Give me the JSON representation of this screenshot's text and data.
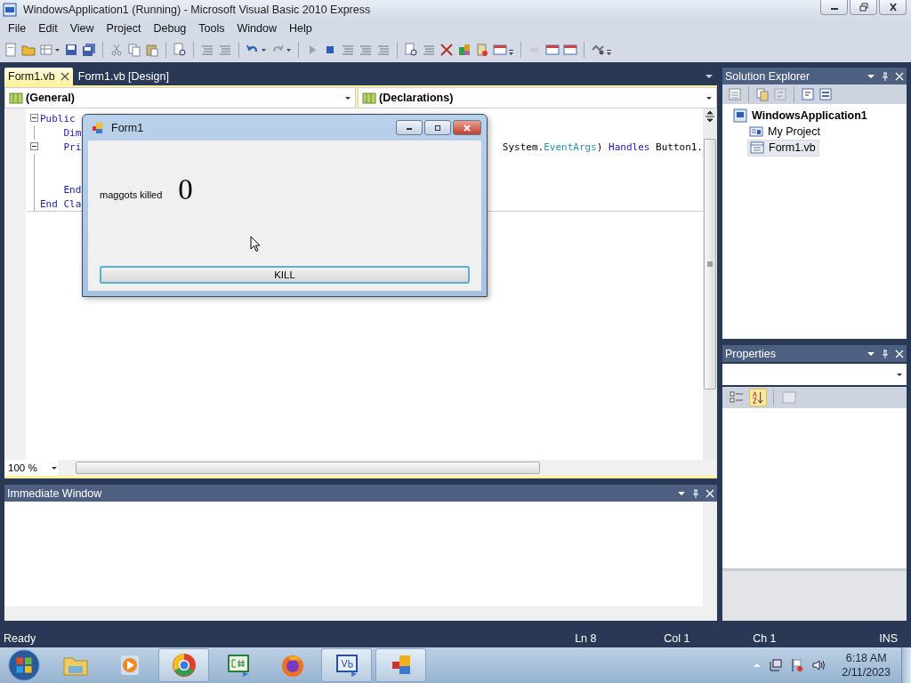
{
  "window": {
    "title": "WindowsApplication1 (Running) - Microsoft Visual Basic 2010 Express"
  },
  "menu": [
    "File",
    "Edit",
    "View",
    "Project",
    "Debug",
    "Tools",
    "Window",
    "Help"
  ],
  "editor": {
    "tabs": [
      {
        "label": "Form1.vb",
        "selected": true
      },
      {
        "label": "Form1.vb [Design]",
        "selected": false
      }
    ],
    "class_dropdown": "(General)",
    "method_dropdown": "(Declarations)",
    "code_lines": [
      {
        "collapsible": true,
        "tokens": [
          {
            "text": "Public",
            "kind": "keyword"
          }
        ]
      },
      {
        "collapsible": false,
        "tokens": [
          {
            "text": "    Dim",
            "kind": "keyword"
          }
        ]
      },
      {
        "collapsible": true,
        "tokens": [
          {
            "text": "    Pri",
            "kind": "keyword"
          }
        ],
        "tail": [
          {
            "text": "System.",
            "kind": "plain"
          },
          {
            "text": "EventArgs",
            "kind": "type"
          },
          {
            "text": ") ",
            "kind": "plain"
          },
          {
            "text": "Handles",
            "kind": "keyword"
          },
          {
            "text": " Button1.",
            "kind": "plain"
          }
        ]
      },
      {
        "collapsible": false
      },
      {
        "collapsible": false
      },
      {
        "collapsible": false,
        "tokens": [
          {
            "text": "    End",
            "kind": "keyword"
          }
        ]
      },
      {
        "collapsible": false,
        "tokens": [
          {
            "text": "End Cla",
            "kind": "keyword"
          }
        ]
      }
    ],
    "zoom": "100 %"
  },
  "form_window": {
    "title": "Form1",
    "label": "maggots killed",
    "count": "0",
    "button": "KILL"
  },
  "immediate_window": {
    "title": "Immediate Window"
  },
  "solution_explorer": {
    "title": "Solution Explorer",
    "tree": [
      {
        "label": "WindowsApplication1",
        "kind": "project",
        "selected": false,
        "children": [
          {
            "label": "My Project",
            "kind": "settings",
            "selected": false
          },
          {
            "label": "Form1.vb",
            "kind": "form",
            "selected": true
          }
        ]
      }
    ]
  },
  "properties": {
    "title": "Properties",
    "alphabetical": true
  },
  "status_bar": {
    "message": "Ready",
    "line": "Ln 8",
    "column": "Col 1",
    "char": "Ch 1",
    "mode": "INS"
  },
  "taskbar": {
    "apps": [
      {
        "kind": "folder",
        "running": false
      },
      {
        "kind": "media",
        "running": false
      },
      {
        "kind": "browser",
        "running": true
      },
      {
        "kind": "csharp",
        "running": false
      },
      {
        "kind": "fox",
        "running": false
      },
      {
        "kind": "vb",
        "running": true
      },
      {
        "kind": "tiles",
        "running": true
      }
    ],
    "clock": {
      "time": "6:18 AM",
      "date": "2/11/2023"
    }
  }
}
